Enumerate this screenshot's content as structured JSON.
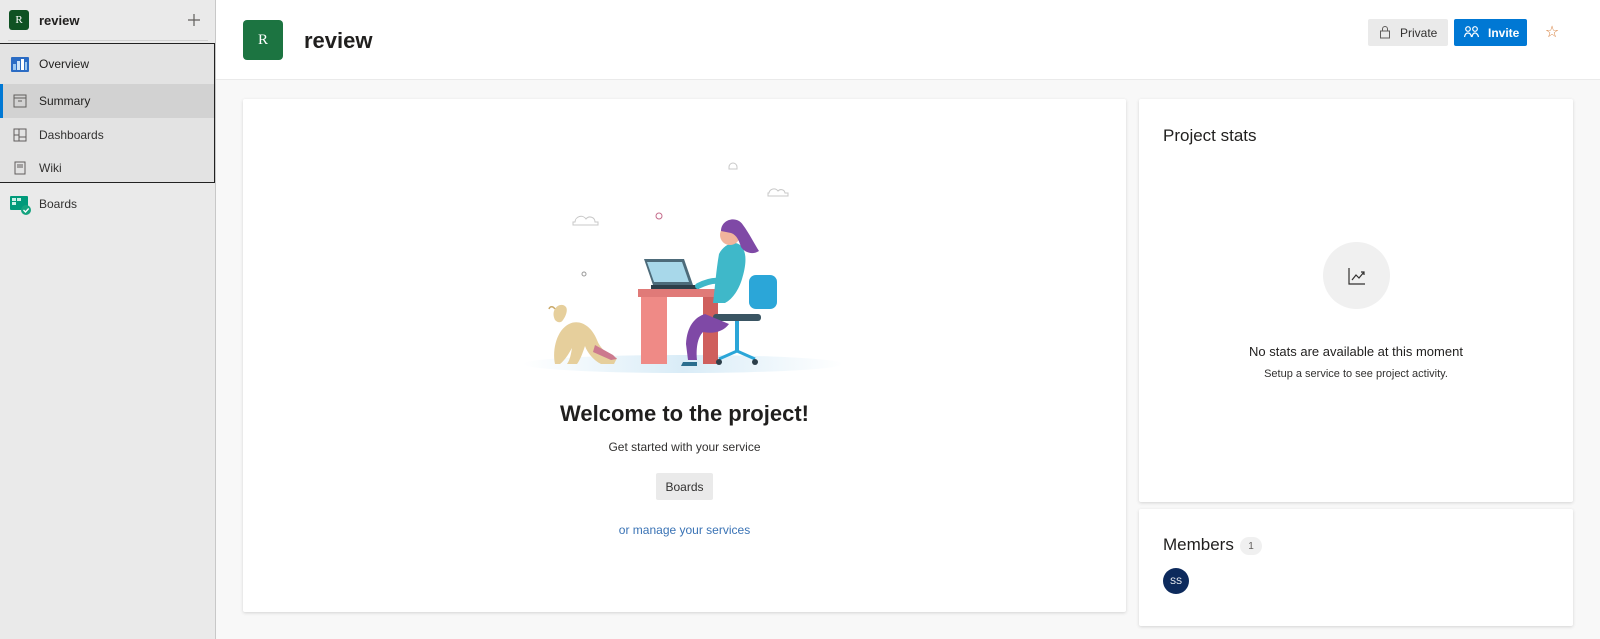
{
  "sidebar": {
    "project_initial": "R",
    "project_name": "review",
    "items": [
      {
        "label": "Overview",
        "icon": "overview-icon"
      },
      {
        "label": "Summary",
        "icon": "summary-icon"
      },
      {
        "label": "Dashboards",
        "icon": "dashboards-icon"
      },
      {
        "label": "Wiki",
        "icon": "wiki-icon"
      },
      {
        "label": "Boards",
        "icon": "boards-icon"
      }
    ]
  },
  "header": {
    "project_initial": "R",
    "title": "review",
    "private_label": "Private",
    "invite_label": "Invite",
    "favorite_icon": "star-icon"
  },
  "welcome": {
    "title": "Welcome to the project!",
    "subtitle": "Get started with your service",
    "boards_button": "Boards",
    "manage_link": "or manage your services"
  },
  "stats": {
    "title": "Project stats",
    "empty_title": "No stats are available at this moment",
    "empty_subtitle": "Setup a service to see project activity."
  },
  "members": {
    "title": "Members",
    "count": "1",
    "avatars": [
      {
        "initials": "SS"
      }
    ]
  },
  "colors": {
    "accent": "#0078d4",
    "project_badge": "#1c7441",
    "link": "#3a73b5",
    "star": "#d67f3c",
    "avatar": "#0d2a5c"
  }
}
